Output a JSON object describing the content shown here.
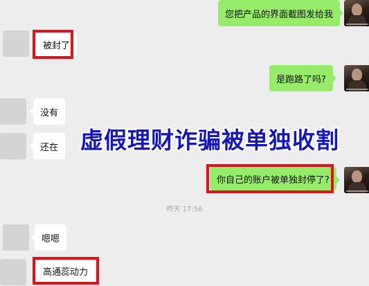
{
  "messages": [
    {
      "side": "out",
      "text": "您把产品的界面截图发给我"
    },
    {
      "side": "in",
      "text": "被封了"
    },
    {
      "side": "out",
      "text": "是跑路了吗?"
    },
    {
      "side": "in",
      "text": "没有"
    },
    {
      "side": "in",
      "text": "还在"
    },
    {
      "side": "out",
      "text": "你自己的账户被单独封停了?"
    },
    {
      "side": "in",
      "text": "嗯嗯"
    },
    {
      "side": "in",
      "text": "高通蕊动力"
    }
  ],
  "timestamp": "昨天 17:56",
  "overlay_headline": "虚假理财诈骗被单独收割",
  "colors": {
    "background": "#ededed",
    "incoming_bubble": "#ffffff",
    "outgoing_bubble": "#95ec69",
    "highlight_box": "#e3101b",
    "headline": "#1717b8"
  }
}
